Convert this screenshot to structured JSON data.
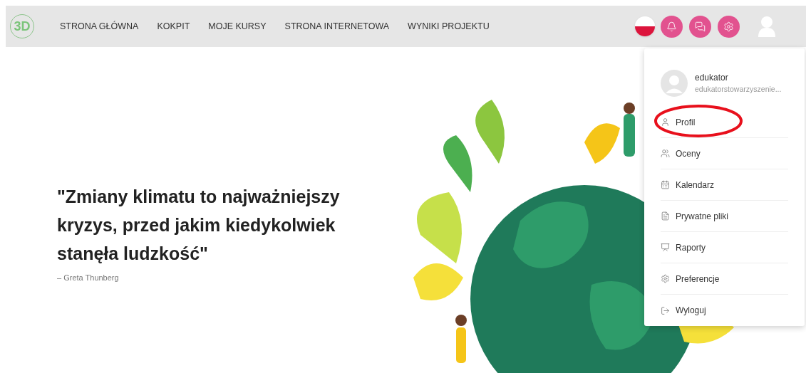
{
  "logo": {
    "text": "3D"
  },
  "nav": [
    {
      "label": "STRONA GŁÓWNA"
    },
    {
      "label": "KOKPIT"
    },
    {
      "label": "MOJE KURSY"
    },
    {
      "label": "STRONA INTERNETOWA"
    },
    {
      "label": "WYNIKI PROJEKTU"
    }
  ],
  "toolbar": [
    {
      "kind": "flag"
    },
    {
      "kind": "notifications"
    },
    {
      "kind": "messages"
    },
    {
      "kind": "settings"
    },
    {
      "kind": "user"
    }
  ],
  "user_menu": {
    "name": "edukator",
    "email": "edukatorstowarzyszenie...",
    "items": [
      {
        "label": "Profil",
        "kind": "profile",
        "circled": true
      },
      {
        "label": "Oceny",
        "kind": "grades",
        "circled": false
      },
      {
        "label": "Kalendarz",
        "kind": "calendar",
        "circled": false
      },
      {
        "label": "Prywatne pliki",
        "kind": "files",
        "circled": false
      },
      {
        "label": "Raporty",
        "kind": "reports",
        "circled": false
      },
      {
        "label": "Preferencje",
        "kind": "preferences",
        "circled": false
      },
      {
        "label": "Wyloguj",
        "kind": "logout",
        "circled": false
      }
    ]
  },
  "quote": {
    "text": "\"Zmiany klimatu to najważniejszy kryzys, przed jakim kiedykolwiek stanęła ludzkość\"",
    "author": "– Greta Thunberg"
  }
}
